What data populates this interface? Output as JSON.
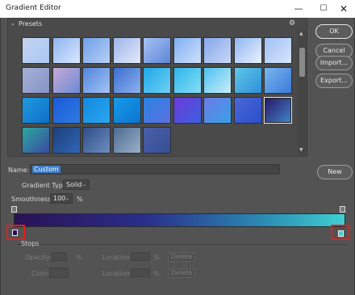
{
  "window": {
    "title": "Gradient Editor",
    "controls": {
      "minimize": "—",
      "maximize": "☐",
      "close": "✕"
    }
  },
  "presets": {
    "label": "Presets",
    "gear_icon": "⚙",
    "chevron_icon": "⌄",
    "swatches": [
      [
        "#c4d4f0",
        "#a8c8f4"
      ],
      [
        "#8fb3ef",
        "#d9e8ff"
      ],
      [
        "#6f9fe8",
        "#b8cff5"
      ],
      [
        "#9eb5ea",
        "#e2e9fb"
      ],
      [
        "#a8c4f4",
        "#5d84d6"
      ],
      [
        "#7fb0f2",
        "#cfe0fb"
      ],
      [
        "#86a7ea",
        "#c9d6f6"
      ],
      [
        "#8fb6f1",
        "#eaf1ff"
      ],
      [
        "#9fc0f5",
        "#d8e5fb"
      ],
      [
        "#a3b1d8",
        "#8794c6"
      ],
      [
        "#c4a9d6",
        "#6e8bd6"
      ],
      [
        "#5286de",
        "#a3c2f2"
      ],
      [
        "#3b6fd0",
        "#8cb0ee"
      ],
      [
        "#1ea8e8",
        "#6fd0f3"
      ],
      [
        "#2db6ea",
        "#87def5"
      ],
      [
        "#4fc2ef",
        "#c7ecfa"
      ],
      [
        "#5ec6e8",
        "#2f90d8"
      ],
      [
        "#78b6ee",
        "#3b7ad8"
      ],
      [
        "#1f9ae0",
        "#0f6fc8"
      ],
      [
        "#1a5ad6",
        "#2e7be3"
      ],
      [
        "#1388e0",
        "#2aa7ee"
      ],
      [
        "#169be6",
        "#0d73d2"
      ],
      [
        "#2a84e2",
        "#5b6fe0"
      ],
      [
        "#6a3bd9",
        "#3e5fe0"
      ],
      [
        "#6b7be4",
        "#3aa0ea"
      ],
      [
        "#4a68d8",
        "#2a4fc8"
      ],
      [
        "#2a1565",
        "#3e86c8"
      ],
      [
        "#2aa8a0",
        "#3b4aa0"
      ],
      [
        "#1e3f7a",
        "#2f66b8"
      ],
      [
        "#2c4d86",
        "#6f8dc0"
      ],
      [
        "#4c6b92",
        "#9ab0c8"
      ],
      [
        "#4a5ea8",
        "#364f94"
      ]
    ]
  },
  "buttons": {
    "ok": "OK",
    "cancel": "Cancel",
    "import": "Import...",
    "export": "Export...",
    "new": "New"
  },
  "name": {
    "label": "Name:",
    "value": "Custom"
  },
  "gradient_type": {
    "label": "Gradient Type:",
    "value": "Solid"
  },
  "smoothness": {
    "label": "Smoothness:",
    "value": "100",
    "unit": "%"
  },
  "gradient": {
    "start_color": "#2a1155",
    "end_color": "#3fd0d2"
  },
  "stops": {
    "label": "Stops",
    "opacity_label": "Opacity:",
    "opacity_unit": "%",
    "location_label_1": "Location:",
    "location_unit_1": "%",
    "delete_1": "Delete",
    "color_label": "Color:",
    "location_label_2": "Location:",
    "location_unit_2": "%",
    "delete_2": "Delete"
  }
}
